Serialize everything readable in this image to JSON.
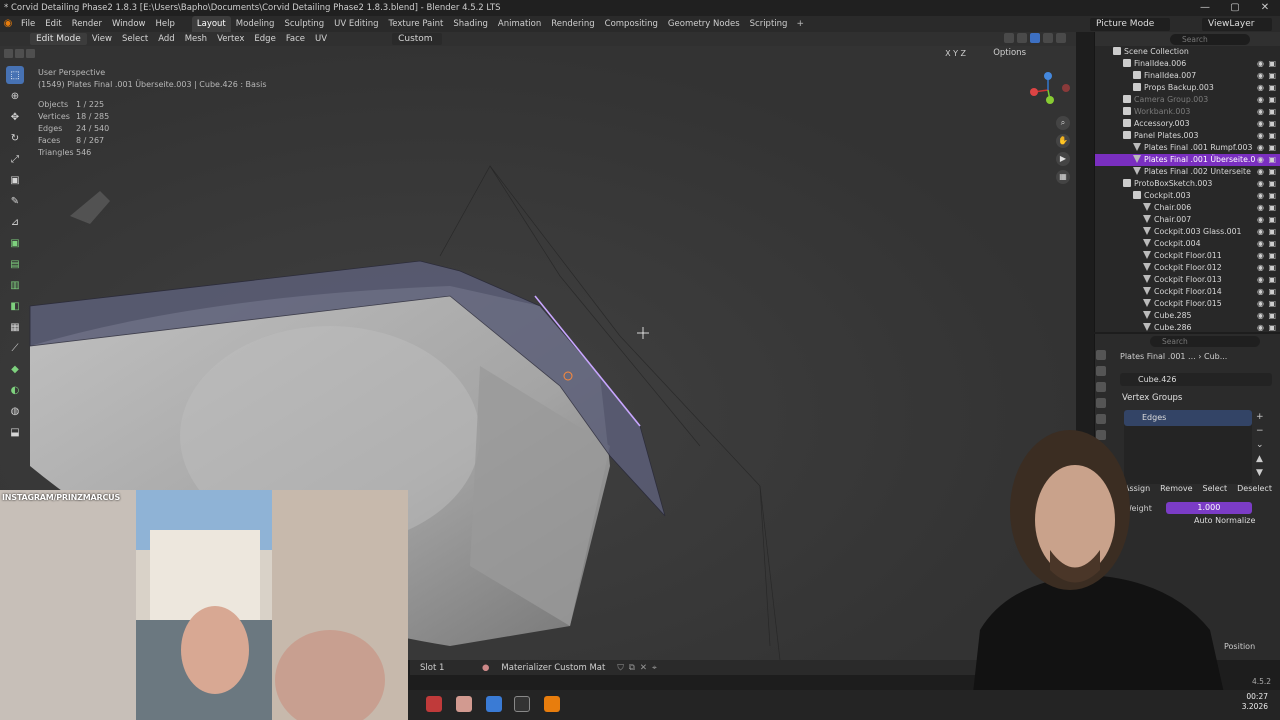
{
  "window": {
    "title": "* Corvid Detailing Phase2 1.8.3 [E:\\Users\\Bapho\\Documents\\Corvid Detailing Phase2 1.8.3.blend] - Blender 4.5.2 LTS",
    "controls": [
      "—",
      "▢",
      "✕"
    ]
  },
  "menubar": {
    "menus": [
      "File",
      "Edit",
      "Render",
      "Window",
      "Help"
    ],
    "workspaces": [
      "Layout",
      "Modeling",
      "Sculpting",
      "UV Editing",
      "Texture Paint",
      "Shading",
      "Animation",
      "Rendering",
      "Compositing",
      "Geometry Nodes",
      "Scripting"
    ],
    "active_workspace": "Layout",
    "scene": "Picture Mode",
    "view_layer": "ViewLayer"
  },
  "viewport_header": {
    "mode": "Edit Mode",
    "menus": [
      "View",
      "Select",
      "Add",
      "Mesh",
      "Vertex",
      "Edge",
      "Face",
      "UV"
    ],
    "orientation": "Custom",
    "axes": "X Y Z",
    "options": "Options"
  },
  "overlay_info": {
    "view_name": "User Perspective",
    "object_line": "(1549) Plates Final .001 Überseite.003 | Cube.426 : Basis",
    "stats": [
      {
        "label": "Objects",
        "value": "1 / 225"
      },
      {
        "label": "Vertices",
        "value": "18 / 285"
      },
      {
        "label": "Edges",
        "value": "24 / 540"
      },
      {
        "label": "Faces",
        "value": "8 / 267"
      },
      {
        "label": "Triangles",
        "value": "546"
      }
    ]
  },
  "viewport_footer": {
    "slot": "Slot 1",
    "material": "Materializer Custom Mat"
  },
  "outliner": {
    "search_placeholder": "Search",
    "rows": [
      {
        "label": "Scene Collection",
        "indent": 0,
        "type": "coll",
        "state": "normal"
      },
      {
        "label": "FinalIdea.006",
        "indent": 1,
        "type": "coll",
        "state": "normal"
      },
      {
        "label": "FinalIdea.007",
        "indent": 2,
        "type": "coll",
        "state": "normal"
      },
      {
        "label": "Props Backup.003",
        "indent": 2,
        "type": "coll",
        "state": "normal"
      },
      {
        "label": "Camera Group.003",
        "indent": 1,
        "type": "coll",
        "state": "dim"
      },
      {
        "label": "Workbank.003",
        "indent": 1,
        "type": "coll",
        "state": "dim"
      },
      {
        "label": "Accessory.003",
        "indent": 1,
        "type": "coll",
        "state": "normal"
      },
      {
        "label": "Panel Plates.003",
        "indent": 1,
        "type": "coll",
        "state": "normal"
      },
      {
        "label": "Plates Final .001 Rumpf.003",
        "indent": 2,
        "type": "mesh",
        "state": "normal"
      },
      {
        "label": "Plates Final .001 Überseite.0",
        "indent": 2,
        "type": "mesh",
        "state": "sel"
      },
      {
        "label": "Plates Final .002 Unterseite",
        "indent": 2,
        "type": "mesh",
        "state": "normal"
      },
      {
        "label": "ProtoBoxSketch.003",
        "indent": 1,
        "type": "coll",
        "state": "normal"
      },
      {
        "label": "Cockpit.003",
        "indent": 2,
        "type": "coll",
        "state": "normal"
      },
      {
        "label": "Chair.006",
        "indent": 3,
        "type": "mesh",
        "state": "normal"
      },
      {
        "label": "Chair.007",
        "indent": 3,
        "type": "mesh",
        "state": "normal"
      },
      {
        "label": "Cockpit.003 Glass.001",
        "indent": 3,
        "type": "mesh",
        "state": "normal"
      },
      {
        "label": "Cockpit.004",
        "indent": 3,
        "type": "mesh",
        "state": "normal"
      },
      {
        "label": "Cockpit Floor.011",
        "indent": 3,
        "type": "mesh",
        "state": "normal"
      },
      {
        "label": "Cockpit Floor.012",
        "indent": 3,
        "type": "mesh",
        "state": "normal"
      },
      {
        "label": "Cockpit Floor.013",
        "indent": 3,
        "type": "mesh",
        "state": "normal"
      },
      {
        "label": "Cockpit Floor.014",
        "indent": 3,
        "type": "mesh",
        "state": "normal"
      },
      {
        "label": "Cockpit Floor.015",
        "indent": 3,
        "type": "mesh",
        "state": "normal"
      },
      {
        "label": "Cube.285",
        "indent": 3,
        "type": "mesh",
        "state": "normal"
      },
      {
        "label": "Cube.286",
        "indent": 3,
        "type": "mesh",
        "state": "normal"
      }
    ]
  },
  "properties": {
    "search_placeholder": "Search",
    "breadcrumb_obj": "Plates Final .001 ...",
    "breadcrumb_mesh": "Cub...",
    "mesh_name": "Cube.426",
    "panel_title": "Vertex Groups",
    "vertex_groups": [
      "Edges"
    ],
    "buttons": [
      "Assign",
      "Remove",
      "Select",
      "Deselect"
    ],
    "weight_label": "Weight",
    "weight_value": "1.000",
    "auto_normalize": "Auto Normalize",
    "position_label": "Position"
  },
  "overlays": {
    "instagram": "INSTAGRAM/PRINZMARCUS"
  },
  "statusbar": {
    "version": "4.5.2",
    "time": "00:27",
    "date": "3.2026"
  },
  "colors": {
    "accent_blue": "#4772b3",
    "selection_purple": "#7a2fc0",
    "weight_purple": "#7b3cc6",
    "blender_orange": "#e87d0d"
  }
}
